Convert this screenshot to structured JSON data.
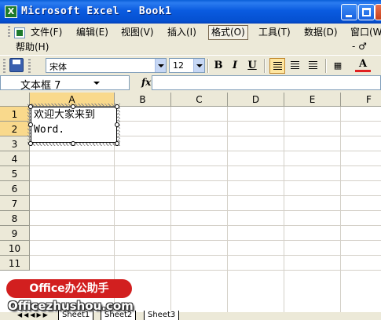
{
  "window": {
    "title": "Microsoft Excel - Book1",
    "app_icon_letter": "X"
  },
  "menu": {
    "items": [
      "文件(F)",
      "编辑(E)",
      "视图(V)",
      "插入(I)",
      "格式(O)",
      "工具(T)",
      "数据(D)",
      "窗口(W)"
    ],
    "active_index": 4,
    "help": "帮助(H)",
    "right_controls": "- ♂"
  },
  "toolbar": {
    "font_name": "宋体",
    "font_size": "12",
    "bold": "B",
    "italic": "I",
    "underline": "U",
    "font_color_label": "A"
  },
  "formula_bar": {
    "name_box": "文本框 7",
    "fx": "fx",
    "formula": ""
  },
  "sheet": {
    "columns": [
      "A",
      "B",
      "C",
      "D",
      "E",
      "F"
    ],
    "rows": [
      "1",
      "2",
      "3",
      "4",
      "5",
      "6",
      "7",
      "8",
      "9",
      "10",
      "11"
    ],
    "selected_column": "A",
    "selected_rows": [
      "1",
      "2"
    ]
  },
  "textbox": {
    "line1": "欢迎大家来到",
    "line2": "Word."
  },
  "sheet_tabs": [
    "Sheet1",
    "Sheet2",
    "Sheet3"
  ],
  "watermark": {
    "badge": "Office办公助手",
    "url": "Officezhushou.com"
  },
  "colors": {
    "title_blue": "#0a5be0",
    "selected_header": "#f9d98c",
    "watermark_red": "#d21f1f"
  }
}
